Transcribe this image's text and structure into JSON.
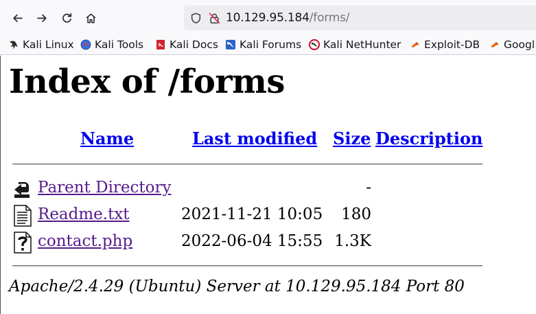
{
  "browser": {
    "url": {
      "host": "10.129.95.184",
      "path": "/forms/"
    },
    "bookmarks": [
      {
        "label": "Kali Linux",
        "icon": "kali-dragon-icon"
      },
      {
        "label": "Kali Tools",
        "icon": "kali-tools-icon"
      },
      {
        "label": "Kali Docs",
        "icon": "kali-docs-icon"
      },
      {
        "label": "Kali Forums",
        "icon": "kali-forums-icon"
      },
      {
        "label": "Kali NetHunter",
        "icon": "kali-nethunter-icon"
      },
      {
        "label": "Exploit-DB",
        "icon": "exploit-db-icon"
      },
      {
        "label": "Googl",
        "icon": "google-hacking-db-icon"
      }
    ]
  },
  "page": {
    "title": "Index of /forms",
    "columns": {
      "name": "Name",
      "last_modified": "Last modified",
      "size": "Size",
      "description": "Description"
    },
    "rows": [
      {
        "name": "Parent Directory",
        "modified": "",
        "size": "-",
        "icon": "back-folder-icon"
      },
      {
        "name": "Readme.txt",
        "modified": "2021-11-21 10:05",
        "size": "180",
        "icon": "text-file-icon"
      },
      {
        "name": "contact.php",
        "modified": "2022-06-04 15:55",
        "size": "1.3K",
        "icon": "unknown-file-icon"
      }
    ],
    "footer": "Apache/2.4.29 (Ubuntu) Server at 10.129.95.184 Port 80"
  }
}
